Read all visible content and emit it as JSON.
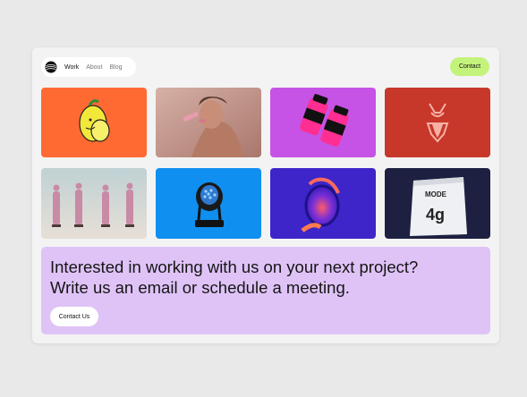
{
  "nav": {
    "logo_icon": "spiral-globe-logo",
    "items": [
      {
        "label": "Work",
        "active": true
      },
      {
        "label": "About",
        "active": false
      },
      {
        "label": "Blog",
        "active": false
      }
    ],
    "contact_label": "Contact"
  },
  "grid": {
    "tiles": [
      {
        "subject": "lemon illustration",
        "bg": "#ff6a33"
      },
      {
        "subject": "woman with lipstick",
        "bg": "#c89a8f"
      },
      {
        "subject": "pink supplement bottles",
        "bg": "#c653e6"
      },
      {
        "subject": "swimsuit outline",
        "bg": "#c7382a"
      },
      {
        "subject": "models in pink outfits",
        "bg": "#cfd7d8"
      },
      {
        "subject": "stage light",
        "bg": "#0f8ff0"
      },
      {
        "subject": "hand holding lens",
        "bg": "#4a2bd0"
      },
      {
        "subject": "pouch",
        "bg": "#1d2040",
        "pouch_brand": "MODE",
        "pouch_amount": "4g"
      }
    ]
  },
  "cta": {
    "line1": "Interested in working with us on your next project?",
    "line2": "Write us an email or schedule a meeting.",
    "button_label": "Contact Us",
    "bg": "#dfc3f7"
  },
  "colors": {
    "accent": "#c4f37c"
  }
}
